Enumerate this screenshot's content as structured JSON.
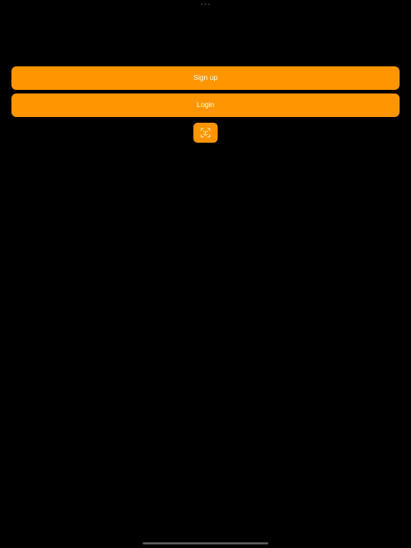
{
  "buttons": {
    "signup_label": "Sign up",
    "login_label": "Login"
  },
  "icons": {
    "biometric": "face-id-icon"
  },
  "colors": {
    "background": "#000000",
    "accent": "#FF9500",
    "button_text": "#FFFFFF"
  }
}
